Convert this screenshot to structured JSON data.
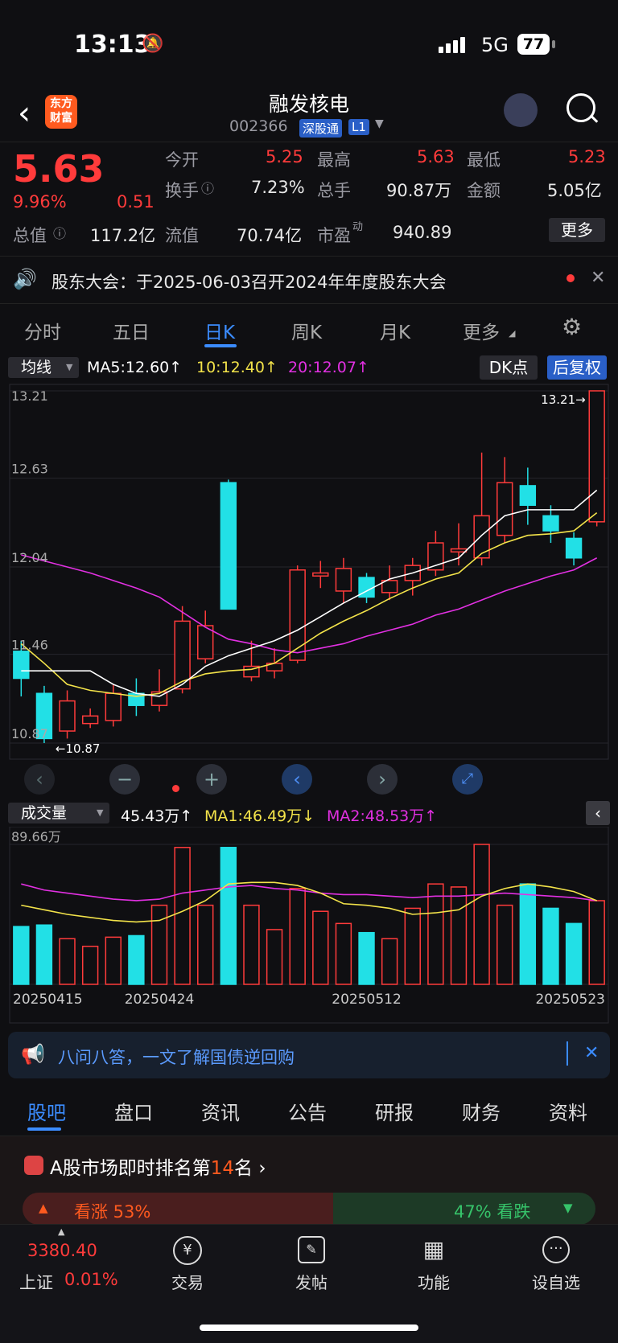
{
  "status": {
    "time": "13:13",
    "network": "5G",
    "battery": "77"
  },
  "nav": {
    "title": "融发核电",
    "code": "002366",
    "tag1": "深股通",
    "tag2": "L1",
    "logo": "东方\n财富"
  },
  "quote": {
    "price": "5.63",
    "pct": "9.96%",
    "chg": "0.51",
    "open_label": "今开",
    "open": "5.25",
    "high_label": "最高",
    "high": "5.63",
    "low_label": "最低",
    "low": "5.23",
    "turnover_label": "换手",
    "turnover": "7.23%",
    "vol_label": "总手",
    "vol": "90.87万",
    "amount_label": "金额",
    "amount": "5.05亿",
    "mcap_label": "总值",
    "mcap": "117.2亿",
    "float_label": "流值",
    "float": "70.74亿",
    "pe_label": "市盈",
    "pe_sup": "动",
    "pe": "940.89",
    "more": "更多"
  },
  "notice": {
    "text": "股东大会：于2025-06-03召开2024年年度股东大会"
  },
  "tabs": [
    "分时",
    "五日",
    "日K",
    "周K",
    "月K",
    "更多"
  ],
  "active_tab": "日K",
  "indicator": {
    "select": "均线",
    "ma5": "MA5:12.60↑",
    "ma10": "10:12.40↑",
    "ma20": "20:12.07↑",
    "dk": "DK点",
    "adj": "后复权"
  },
  "volume_bar": {
    "select": "成交量",
    "vol": "45.43万↑",
    "ma1": "MA1:46.49万↓",
    "ma2": "MA2:48.53万↑",
    "max": "89.66万"
  },
  "chart_data": {
    "type": "candlestick",
    "y_ticks": [
      "13.21",
      "12.63",
      "12.04",
      "11.46",
      "10.87"
    ],
    "ylim": [
      10.87,
      13.21
    ],
    "high_label": "13.21→",
    "low_label": "←10.87",
    "candles": [
      {
        "o": 11.3,
        "c": 11.48,
        "h": 11.55,
        "l": 11.18,
        "up": false
      },
      {
        "o": 11.2,
        "c": 10.9,
        "h": 11.25,
        "l": 10.87,
        "up": false
      },
      {
        "o": 10.95,
        "c": 11.15,
        "h": 11.22,
        "l": 10.9,
        "up": true
      },
      {
        "o": 11.0,
        "c": 11.05,
        "h": 11.1,
        "l": 10.97,
        "up": true
      },
      {
        "o": 11.02,
        "c": 11.2,
        "h": 11.26,
        "l": 10.98,
        "up": true
      },
      {
        "o": 11.2,
        "c": 11.12,
        "h": 11.3,
        "l": 11.05,
        "up": false
      },
      {
        "o": 11.12,
        "c": 11.21,
        "h": 11.36,
        "l": 11.08,
        "up": true
      },
      {
        "o": 11.23,
        "c": 11.68,
        "h": 11.78,
        "l": 11.2,
        "up": true
      },
      {
        "o": 11.43,
        "c": 11.65,
        "h": 11.75,
        "l": 11.4,
        "up": true
      },
      {
        "o": 12.6,
        "c": 11.76,
        "h": 12.62,
        "l": 11.76,
        "up": false
      },
      {
        "o": 11.31,
        "c": 11.38,
        "h": 11.55,
        "l": 11.28,
        "up": true
      },
      {
        "o": 11.35,
        "c": 11.4,
        "h": 11.5,
        "l": 11.3,
        "up": true
      },
      {
        "o": 11.42,
        "c": 12.02,
        "h": 12.05,
        "l": 11.4,
        "up": true
      },
      {
        "o": 11.98,
        "c": 12.0,
        "h": 12.08,
        "l": 11.9,
        "up": true
      },
      {
        "o": 11.88,
        "c": 12.03,
        "h": 12.1,
        "l": 11.8,
        "up": true
      },
      {
        "o": 11.97,
        "c": 11.84,
        "h": 12.0,
        "l": 11.8,
        "up": false
      },
      {
        "o": 11.87,
        "c": 11.95,
        "h": 12.05,
        "l": 11.82,
        "up": true
      },
      {
        "o": 11.95,
        "c": 12.05,
        "h": 12.1,
        "l": 11.85,
        "up": true
      },
      {
        "o": 12.02,
        "c": 12.2,
        "h": 12.28,
        "l": 11.98,
        "up": true
      },
      {
        "o": 12.14,
        "c": 12.16,
        "h": 12.33,
        "l": 12.05,
        "up": true
      },
      {
        "o": 12.1,
        "c": 12.38,
        "h": 12.8,
        "l": 12.05,
        "up": true
      },
      {
        "o": 12.25,
        "c": 12.6,
        "h": 12.77,
        "l": 12.2,
        "up": true
      },
      {
        "o": 12.58,
        "c": 12.45,
        "h": 12.7,
        "l": 12.32,
        "up": false
      },
      {
        "o": 12.38,
        "c": 12.28,
        "h": 12.45,
        "l": 12.2,
        "up": false
      },
      {
        "o": 12.23,
        "c": 12.1,
        "h": 12.27,
        "l": 12.05,
        "up": false
      },
      {
        "o": 12.34,
        "c": 13.21,
        "h": 13.21,
        "l": 12.31,
        "up": true
      }
    ],
    "ma5": [
      11.35,
      11.35,
      11.35,
      11.35,
      11.26,
      11.2,
      11.18,
      11.26,
      11.38,
      11.45,
      11.5,
      11.55,
      11.62,
      11.71,
      11.8,
      11.88,
      11.96,
      12.0,
      12.05,
      12.1,
      12.25,
      12.38,
      12.42,
      12.42,
      12.42,
      12.55
    ],
    "ma10": [
      11.53,
      11.4,
      11.26,
      11.22,
      11.2,
      11.18,
      11.2,
      11.28,
      11.33,
      11.35,
      11.36,
      11.4,
      11.5,
      11.6,
      11.68,
      11.75,
      11.83,
      11.9,
      11.96,
      12.0,
      12.13,
      12.2,
      12.25,
      12.26,
      12.28,
      12.4
    ],
    "ma20": [
      12.12,
      12.08,
      12.04,
      12.0,
      11.95,
      11.9,
      11.84,
      11.74,
      11.64,
      11.56,
      11.53,
      11.49,
      11.47,
      11.5,
      11.53,
      11.58,
      11.62,
      11.66,
      11.72,
      11.76,
      11.82,
      11.88,
      11.93,
      11.98,
      12.02,
      12.1
    ],
    "volumes": [
      38,
      39,
      30,
      25,
      31,
      32,
      52,
      90,
      52,
      90,
      52,
      36,
      63,
      48,
      40,
      34,
      30,
      50,
      66,
      64,
      92,
      52,
      66,
      50,
      40,
      55
    ],
    "vol_ma1": [
      52,
      49,
      46,
      44,
      42,
      41,
      42,
      48,
      55,
      66,
      67,
      67,
      65,
      60,
      53,
      52,
      50,
      46,
      47,
      49,
      58,
      63,
      66,
      64,
      61,
      55
    ],
    "vol_ma2": [
      66,
      62,
      60,
      58,
      56,
      55,
      56,
      60,
      62,
      64,
      65,
      63,
      62,
      60,
      59,
      59,
      58,
      57,
      58,
      58,
      59,
      60,
      59,
      58,
      57,
      55
    ],
    "x_labels": [
      {
        "i": 0,
        "t": "20250415"
      },
      {
        "i": 6,
        "t": "20250424"
      },
      {
        "i": 15,
        "t": "20250512"
      },
      {
        "i": 24,
        "t": "20250523"
      }
    ]
  },
  "hot": {
    "text": "八问八答，一文了解国债逆回购"
  },
  "bottom_tabs": [
    "股吧",
    "盘口",
    "资讯",
    "公告",
    "研报",
    "财务",
    "资料"
  ],
  "rank": {
    "text_a": "A股市场即时排名第",
    "rank": "14",
    "text_b": "名",
    "up": "看涨 53%",
    "down": "47% 看跌"
  },
  "index": {
    "value": "3380.40",
    "name": "上证",
    "pct": "0.01%"
  },
  "bottom_nav": [
    "交易",
    "发帖",
    "功能",
    "设自选"
  ]
}
